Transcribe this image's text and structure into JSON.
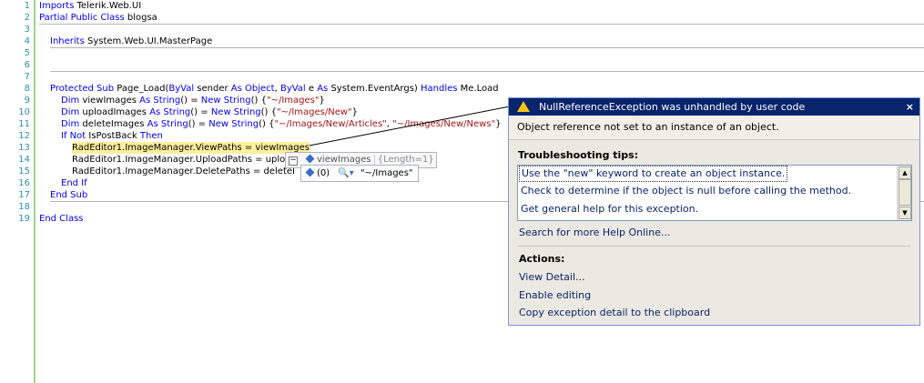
{
  "line_numbers": [
    "1",
    "2",
    "3",
    "4",
    "5",
    "6",
    "7",
    "8",
    "9",
    "10",
    "11",
    "12",
    "13",
    "14",
    "15",
    "16",
    "17",
    "18",
    "19"
  ],
  "code": {
    "l1": {
      "kw": "Imports",
      "rest": " Telerik.Web.UI"
    },
    "l2": {
      "kw": "Partial Public Class",
      "rest": " blogsa"
    },
    "l4": {
      "kw": "Inherits",
      "rest": " System.Web.UI.MasterPage"
    },
    "l8": {
      "kw1": "Protected Sub",
      "mid1": " Page_Load(",
      "kw2": "ByVal",
      "mid2": " sender ",
      "kw3": "As Object",
      "mid3": ", ",
      "kw4": "ByVal",
      "mid4": " e ",
      "kw5": "As",
      "mid5": " System.EventArgs) ",
      "kw6": "Handles",
      "mid6": " Me.Load"
    },
    "l9": {
      "kw1": "Dim",
      "mid1": " viewImages ",
      "kw2": "As String",
      "mid2": "() = ",
      "kw3": "New String",
      "mid3": "() {",
      "str": "\"~/Images\"",
      "end": "}"
    },
    "l10": {
      "kw1": "Dim",
      "mid1": " uploadImages ",
      "kw2": "As String",
      "mid2": "() = ",
      "kw3": "New String",
      "mid3": "() {",
      "str": "\"~/Images/New\"",
      "end": "}"
    },
    "l11": {
      "kw1": "Dim",
      "mid1": " deleteImages ",
      "kw2": "As String",
      "mid2": "() = ",
      "kw3": "New String",
      "mid3": "() {",
      "str1": "\"~/Images/New/Articles\"",
      "comma": ", ",
      "str2": "\"~/Images/New/News\"",
      "end": "}"
    },
    "l12": {
      "kw1": "If",
      "mid1": " ",
      "kw2": "Not",
      "mid2": " IsPostBack ",
      "kw3": "Then"
    },
    "l13": "RadEditor1.ImageManager.ViewPaths = viewImages",
    "l14": "RadEditor1.ImageManager.UploadPaths = uplo",
    "l15": "RadEditor1.ImageManager.DeletePaths = deleteI",
    "l16": "End If",
    "l17": "End Sub",
    "l19": "End Class"
  },
  "datatip": {
    "name": "viewImages",
    "value": "{Length=1}",
    "child_index": "(0)",
    "child_value": "\"~/Images\""
  },
  "exception": {
    "title": "NullReferenceException was unhandled by user code",
    "close": "×",
    "message": "Object reference not set to an instance of an object.",
    "tips_title": "Troubleshooting tips:",
    "tips": [
      "Use the \"new\" keyword to create an object instance.",
      "Check to determine if the object is null before calling the method.",
      "Get general help for this exception."
    ],
    "search_link": "Search for more Help Online...",
    "actions_title": "Actions:",
    "actions": [
      "View Detail...",
      "Enable editing",
      "Copy exception detail to the clipboard"
    ]
  },
  "colors": {
    "keyword": "#0000ff",
    "string": "#a31515",
    "linenumber": "#2b91af",
    "highlight": "#ffef9e",
    "exception_header": "#08246b"
  },
  "icons": [
    "warning-icon",
    "close-icon",
    "watch-icon",
    "magnifier-icon",
    "collapse-icon",
    "scroll-up-icon",
    "scroll-down-icon"
  ]
}
